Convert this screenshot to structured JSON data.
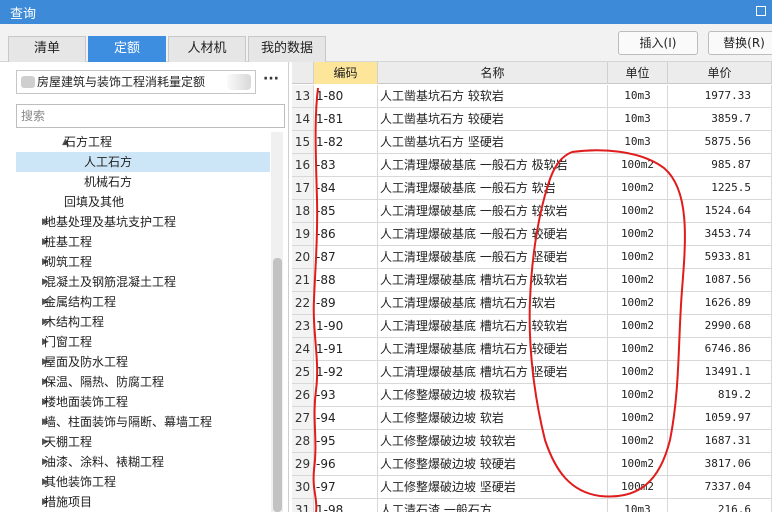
{
  "window": {
    "title": "查询"
  },
  "tabs": [
    {
      "label": "清单",
      "active": false
    },
    {
      "label": "定额",
      "active": true
    },
    {
      "label": "人材机",
      "active": false
    },
    {
      "label": "我的数据",
      "active": false
    }
  ],
  "actions": {
    "insert": "插入(I)",
    "replace": "替换(R)"
  },
  "library": {
    "selected": "房屋建筑与装饰工程消耗量定额",
    "more": "···"
  },
  "search": {
    "placeholder": "搜索"
  },
  "tree": [
    {
      "label": "石方工程",
      "arrow": "▲",
      "level": 3
    },
    {
      "label": "人工石方",
      "arrow": "",
      "level": 4,
      "selected": true
    },
    {
      "label": "机械石方",
      "arrow": "",
      "level": 4
    },
    {
      "label": "回填及其他",
      "arrow": "",
      "level": 3
    },
    {
      "label": "地基处理及基坑支护工程",
      "arrow": "▶",
      "level": 1
    },
    {
      "label": "桩基工程",
      "arrow": "▶",
      "level": 1
    },
    {
      "label": "砌筑工程",
      "arrow": "▶",
      "level": 1
    },
    {
      "label": "混凝土及钢筋混凝土工程",
      "arrow": "▶",
      "level": 1
    },
    {
      "label": "金属结构工程",
      "arrow": "▶",
      "level": 1
    },
    {
      "label": "木结构工程",
      "arrow": "▶",
      "level": 1
    },
    {
      "label": "门窗工程",
      "arrow": "▶",
      "level": 1
    },
    {
      "label": "屋面及防水工程",
      "arrow": "▶",
      "level": 1
    },
    {
      "label": "保温、隔热、防腐工程",
      "arrow": "▶",
      "level": 1
    },
    {
      "label": "楼地面装饰工程",
      "arrow": "▶",
      "level": 1
    },
    {
      "label": "墙、柱面装饰与隔断、幕墙工程",
      "arrow": "▶",
      "level": 1
    },
    {
      "label": "天棚工程",
      "arrow": "▶",
      "level": 1
    },
    {
      "label": "油漆、涂料、裱糊工程",
      "arrow": "▶",
      "level": 1
    },
    {
      "label": "其他装饰工程",
      "arrow": "▶",
      "level": 1
    },
    {
      "label": "措施项目",
      "arrow": "▶",
      "level": 1
    }
  ],
  "grid": {
    "headers": {
      "code": "编码",
      "name": "名称",
      "unit": "单位",
      "price": "单价"
    },
    "rows": [
      {
        "num": "13",
        "code": "1-80",
        "name": "人工凿基坑石方 较软岩",
        "unit": "10m3",
        "price": "1977.33"
      },
      {
        "num": "14",
        "code": "1-81",
        "name": "人工凿基坑石方 较硬岩",
        "unit": "10m3",
        "price": "3859.7"
      },
      {
        "num": "15",
        "code": "1-82",
        "name": "人工凿基坑石方 坚硬岩",
        "unit": "10m3",
        "price": "5875.56"
      },
      {
        "num": "16",
        "code": "-83",
        "name": "人工清理爆破基底 一般石方 极软岩",
        "unit": "100m2",
        "price": "985.87"
      },
      {
        "num": "17",
        "code": "-84",
        "name": "人工清理爆破基底 一般石方 软岩",
        "unit": "100m2",
        "price": "1225.5"
      },
      {
        "num": "18",
        "code": "-85",
        "name": "人工清理爆破基底 一般石方 较软岩",
        "unit": "100m2",
        "price": "1524.64"
      },
      {
        "num": "19",
        "code": "-86",
        "name": "人工清理爆破基底 一般石方 较硬岩",
        "unit": "100m2",
        "price": "3453.74"
      },
      {
        "num": "20",
        "code": "-87",
        "name": "人工清理爆破基底 一般石方 坚硬岩",
        "unit": "100m2",
        "price": "5933.81"
      },
      {
        "num": "21",
        "code": "-88",
        "name": "人工清理爆破基底 槽坑石方 极软岩",
        "unit": "100m2",
        "price": "1087.56"
      },
      {
        "num": "22",
        "code": "-89",
        "name": "人工清理爆破基底 槽坑石方 软岩",
        "unit": "100m2",
        "price": "1626.89"
      },
      {
        "num": "23",
        "code": "1-90",
        "name": "人工清理爆破基底 槽坑石方 较软岩",
        "unit": "100m2",
        "price": "2990.68"
      },
      {
        "num": "24",
        "code": "1-91",
        "name": "人工清理爆破基底 槽坑石方 较硬岩",
        "unit": "100m2",
        "price": "6746.86"
      },
      {
        "num": "25",
        "code": "1-92",
        "name": "人工清理爆破基底 槽坑石方 坚硬岩",
        "unit": "100m2",
        "price": "13491.1"
      },
      {
        "num": "26",
        "code": "-93",
        "name": "人工修整爆破边坡 极软岩",
        "unit": "100m2",
        "price": "819.2"
      },
      {
        "num": "27",
        "code": "-94",
        "name": "人工修整爆破边坡 软岩",
        "unit": "100m2",
        "price": "1059.97"
      },
      {
        "num": "28",
        "code": "-95",
        "name": "人工修整爆破边坡 较软岩",
        "unit": "100m2",
        "price": "1687.31"
      },
      {
        "num": "29",
        "code": "-96",
        "name": "人工修整爆破边坡 较硬岩",
        "unit": "100m2",
        "price": "3817.06"
      },
      {
        "num": "30",
        "code": "-97",
        "name": "人工修整爆破边坡 坚硬岩",
        "unit": "100m2",
        "price": "7337.04"
      },
      {
        "num": "31",
        "code": "1-98",
        "name": "人工清石渣 一般石方",
        "unit": "10m3",
        "price": "216.6"
      }
    ]
  },
  "colors": {
    "titlebar": "#3c8ad8",
    "active_tab": "#3d8ee0",
    "selected_tree": "#cde6f7",
    "active_header": "#fde59a",
    "annotation": "#e01c1c"
  }
}
